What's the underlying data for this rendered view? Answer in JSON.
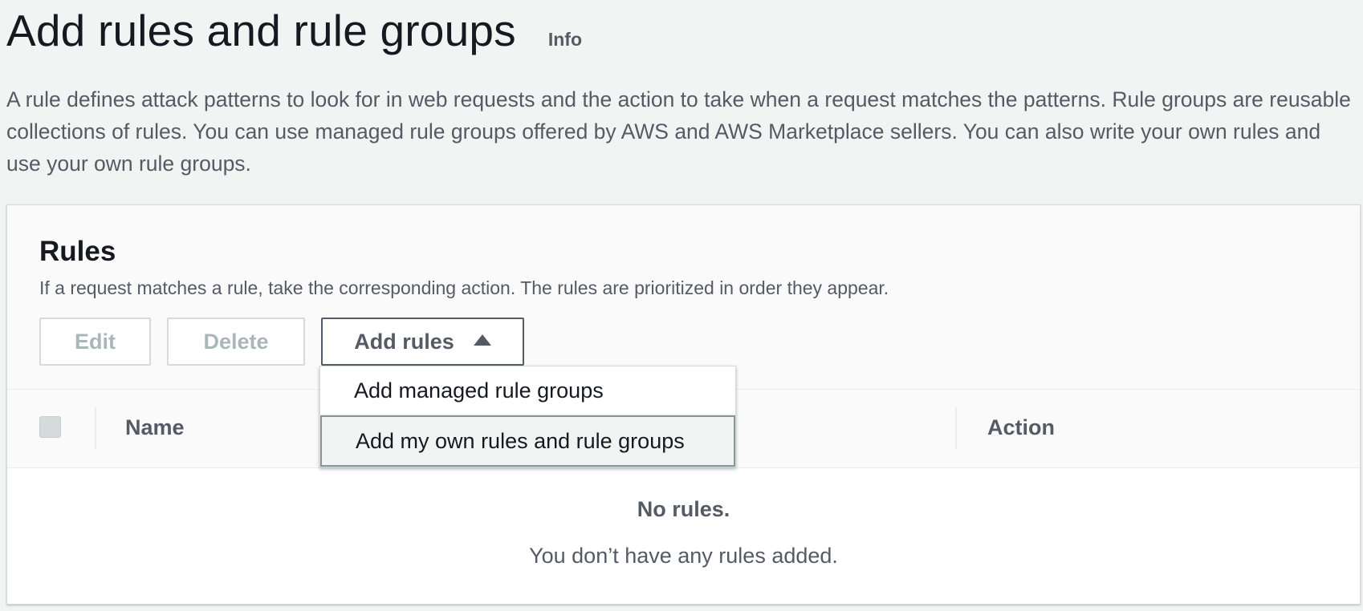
{
  "header": {
    "title": "Add rules and rule groups",
    "info_link": "Info",
    "description": "A rule defines attack patterns to look for in web requests and the action to take when a request matches the patterns. Rule groups are reusable collections of rules. You can use managed rule groups offered by AWS and AWS Marketplace sellers. You can also write your own rules and use your own rule groups."
  },
  "rules_panel": {
    "title": "Rules",
    "description": "If a request matches a rule, take the corresponding action. The rules are prioritized in order they appear.",
    "buttons": {
      "edit": "Edit",
      "delete": "Delete",
      "add_rules": "Add rules"
    },
    "dropdown": {
      "items": [
        {
          "label": "Add managed rule groups"
        },
        {
          "label": "Add my own rules and rule groups"
        }
      ]
    },
    "table": {
      "columns": [
        "Name",
        "Action"
      ],
      "empty_title": "No rules.",
      "empty_description": "You don’t have any rules added."
    }
  }
}
